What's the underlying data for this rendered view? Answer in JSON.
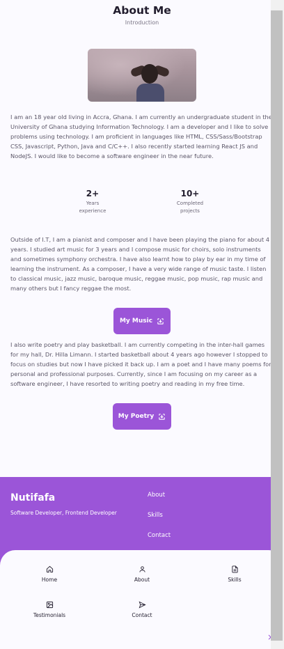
{
  "header": {
    "title": "About Me",
    "subtitle": "Introduction"
  },
  "about": {
    "intro": "I am an 18 year old living in Accra, Ghana. I am currently an undergraduate student in the University of Ghana studying Information Technology. I am a developer and I like to solve problems using technology. I am proficient in languages like HTML, CSS/Sass/Bootstrap CSS, Javascript, Python, Java and C/C++. I also recently started learning React JS and NodeJS. I would like to become a software engineer in the near future.",
    "stats": [
      {
        "value": "2+",
        "label_line1": "Years",
        "label_line2": "experience"
      },
      {
        "value": "10+",
        "label_line1": "Completed",
        "label_line2": "projects"
      }
    ],
    "music": "Outside of I.T, I am a pianist and composer and I have been playing the piano for about 4 years. I studied art music for 3 years and I compose music for choirs, solo instruments and sometimes symphony orchestra. I have also learnt how to play by ear in my time of learning the instrument. As a composer, I have a very wide range of music taste. I listen to classical music, jazz music, baroque music, reggae music, pop music, rap music and many others but I fancy reggae the most.",
    "music_button": "My Music",
    "poetry": "I also write poetry and play basketball. I am currently competing in the inter-hall games for my hall, Dr. Hilla Limann. I started basketball about 4 years ago however I stopped to focus on studies but now I have picked it back up. I am a poet and I have many poems for personal and professional purposes. Currently, since I am focusing on my career as a software engineer, I have resorted to writing poetry and reading in my free time.",
    "poetry_button": "My Poetry"
  },
  "footer": {
    "name": "Nutifafa",
    "tagline": "Software Developer, Frontend Developer",
    "links": [
      "About",
      "Skills",
      "Contact"
    ]
  },
  "bottom_nav": {
    "items": [
      {
        "label": "Home",
        "icon": "home-icon"
      },
      {
        "label": "About",
        "icon": "user-icon"
      },
      {
        "label": "Skills",
        "icon": "file-text-icon"
      },
      {
        "label": "Testimonials",
        "icon": "image-icon"
      },
      {
        "label": "Contact",
        "icon": "send-icon"
      }
    ],
    "close": "×"
  },
  "colors": {
    "accent": "#9b55d8",
    "text": "#5a5566",
    "heading": "#221d2e",
    "background": "#fbfaff"
  }
}
